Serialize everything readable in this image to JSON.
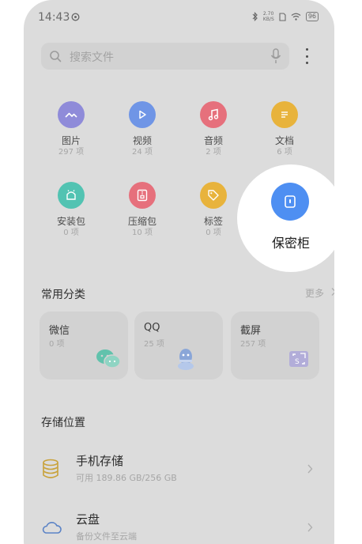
{
  "status_bar": {
    "time": "14:43",
    "net_speed_value": "2.70",
    "net_speed_unit": "KB/S",
    "battery": "96"
  },
  "search": {
    "placeholder": "搜索文件"
  },
  "categories": [
    {
      "label": "图片",
      "count": "297 项",
      "icon": "image-icon",
      "color": "#8f8bd9"
    },
    {
      "label": "视频",
      "count": "24 项",
      "icon": "play-icon",
      "color": "#6f95e6"
    },
    {
      "label": "音频",
      "count": "2 项",
      "icon": "music-icon",
      "color": "#e6707c"
    },
    {
      "label": "文档",
      "count": "6 项",
      "icon": "document-icon",
      "color": "#e8b33c"
    },
    {
      "label": "安装包",
      "count": "0 项",
      "icon": "android-icon",
      "color": "#52c3b2"
    },
    {
      "label": "压缩包",
      "count": "10 项",
      "icon": "archive-icon",
      "color": "#e6707c"
    },
    {
      "label": "标签",
      "count": "0 项",
      "icon": "tag-icon",
      "color": "#e8b33c"
    }
  ],
  "spotlight": {
    "label": "保密柜",
    "icon": "lock-icon",
    "color": "#4e8ff2"
  },
  "common": {
    "title": "常用分类",
    "more": "更多",
    "cards": [
      {
        "title": "微信",
        "count": "0 项",
        "icon": "wechat-icon"
      },
      {
        "title": "QQ",
        "count": "25 项",
        "icon": "qq-icon"
      },
      {
        "title": "截屏",
        "count": "257 项",
        "icon": "screenshot-icon"
      }
    ]
  },
  "storage": {
    "title": "存储位置",
    "items": [
      {
        "name": "手机存储",
        "sub": "可用 189.86 GB/256 GB",
        "icon": "phone-storage-icon"
      },
      {
        "name": "云盘",
        "sub": "备份文件至云端",
        "icon": "cloud-icon"
      }
    ]
  }
}
